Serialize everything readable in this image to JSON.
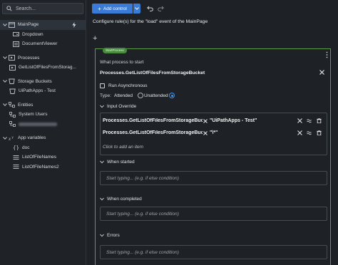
{
  "sidebar": {
    "search_placeholder": "Search...",
    "tree": [
      {
        "label": "MainPage",
        "type": "group",
        "selected": true
      },
      {
        "label": "Dropdown",
        "type": "item"
      },
      {
        "label": "DocumentViewer",
        "type": "item"
      },
      {
        "label": "Processes",
        "type": "group"
      },
      {
        "label": "GetListOfFilesFromStorag...",
        "type": "item"
      },
      {
        "label": "Storage Buckets",
        "type": "group"
      },
      {
        "label": "UiPathApps - Test",
        "type": "item"
      },
      {
        "label": "Entities",
        "type": "group"
      },
      {
        "label": "System Users",
        "type": "item"
      },
      {
        "label": "",
        "type": "item-blurred"
      },
      {
        "label": "App variables",
        "type": "group"
      },
      {
        "label": "doc",
        "type": "item"
      },
      {
        "label": "ListOfFileNames",
        "type": "item"
      },
      {
        "label": "ListOfFileNames2",
        "type": "item"
      }
    ]
  },
  "toolbar": {
    "add_control_label": "Add control"
  },
  "main": {
    "title": "Configure rule(s) for the \"load\" event of the MainPage",
    "add_symbol": "+"
  },
  "rule": {
    "tag": "StartProcess",
    "process_label": "What process to start",
    "process_value": "Processes.GetListOfFilesFromStorageBucket",
    "run_async_label": "Run Asynchronous",
    "type_label": "Type:",
    "type_options": [
      "Attended",
      "Unattended"
    ],
    "type_selected": "Unattended",
    "input_override_label": "Input Override",
    "overrides": [
      {
        "key": "Processes.GetListOfFilesFromStorageBucket...",
        "value": "\"UiPathApps - Test\""
      },
      {
        "key": "Processes.GetListOfFilesFromStorageBucket...",
        "value": "\"\\*\""
      }
    ],
    "add_item_label": "Click to add an item",
    "when_started_label": "When started",
    "when_completed_label": "When completed",
    "errors_label": "Errors",
    "typing_placeholder": "Start typing... (e.g. if else condition)"
  },
  "colors": {
    "accent": "#3a7bd5",
    "rule_border": "#5b9e4a",
    "background": "#1e2227"
  }
}
